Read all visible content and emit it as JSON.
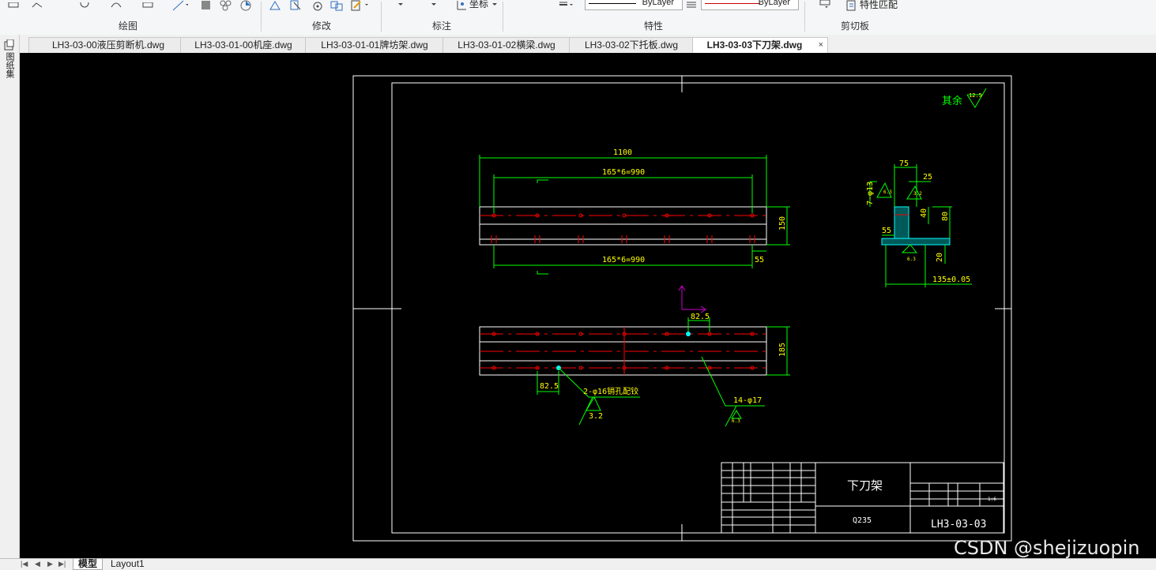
{
  "ribbon": {
    "panels": [
      {
        "label": "绘图"
      },
      {
        "label": "修改"
      },
      {
        "label": "标注"
      },
      {
        "label": "特性"
      },
      {
        "label": "剪切板"
      }
    ],
    "coord_label": "坐标",
    "linetype_value": "ByLayer",
    "lineweight_value": "ByLayer",
    "match_props_label": "特性匹配",
    "linetype_color": "#000000",
    "lineweight_color": "#cc0000"
  },
  "tabs": [
    {
      "label": "LH3-03-00液压剪断机.dwg"
    },
    {
      "label": "LH3-03-01-00机座.dwg"
    },
    {
      "label": "LH3-03-01-01牌坊架.dwg"
    },
    {
      "label": "LH3-03-01-02横梁.dwg"
    },
    {
      "label": "LH3-03-02下托板.dwg"
    },
    {
      "label": "LH3-03-03下刀架.dwg",
      "active": true
    }
  ],
  "tab_close_glyph": "×",
  "left_strip": {
    "label": "图纸集"
  },
  "drawing": {
    "roughness_note": "其余",
    "roughness_value": "12.5",
    "top_view": {
      "overall_dim": "1100",
      "pitch_dim_top": "165*6=990",
      "pitch_dim_bottom": "165*6=990",
      "height_dim": "150",
      "edge_dim": "55"
    },
    "front_view": {
      "offset_dim_top": "82.5",
      "offset_dim_bottom": "82.5",
      "height_dim": "185",
      "pin_hole_note": "2-φ16销孔配铰",
      "pin_roughness": "3.2",
      "hole_note": "14-φ17",
      "hole_roughness": "6.3"
    },
    "section_view": {
      "dim_top": "75",
      "dim_25": "25",
      "dim_40": "40",
      "dim_80": "80",
      "dim_55": "55",
      "dim_20": "20",
      "dim_bottom": "135±0.05",
      "hole_note": "7-φ13",
      "roughness_a": "6.3",
      "roughness_b": "3.2",
      "roughness_c": "6.3"
    },
    "title_block": {
      "part_name": "下刀架",
      "material": "Q235",
      "drawing_number": "LH3-03-03",
      "scale": "1:6"
    },
    "colors": {
      "border": "#ffffff",
      "dimension": "#00ff00",
      "dim_text": "#ffff00",
      "centerline": "#ff0000",
      "hatch": "#00ffff",
      "ucs": "#cc00cc",
      "canvas_bg": "#000000"
    }
  },
  "layout_tabs": [
    {
      "label": "模型",
      "active": true
    },
    {
      "label": "Layout1"
    }
  ],
  "nav_buttons": [
    "|◀",
    "◀",
    "▶",
    "▶|"
  ],
  "watermark": "CSDN @shejizuopin"
}
